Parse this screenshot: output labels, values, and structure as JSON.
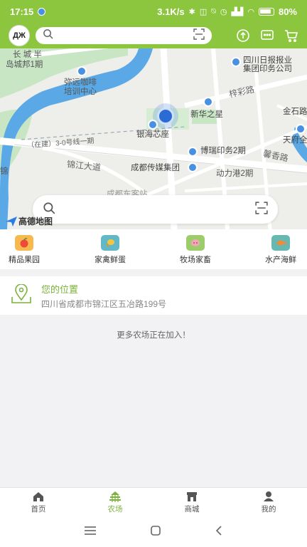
{
  "status_bar": {
    "time": "17:15",
    "network_speed": "3.1K/s",
    "battery": "80%",
    "icons": [
      "telegram-icon",
      "bluetooth-icon",
      "vibrate-icon",
      "mute-icon",
      "alarm-icon",
      "signal-hd-icon",
      "wifi-icon",
      "battery-icon"
    ]
  },
  "header": {
    "logo_text": "ДЖ",
    "search_placeholder": "",
    "icons": [
      "search-icon",
      "scan-icon",
      "upload-icon",
      "message-icon",
      "cart-icon"
    ]
  },
  "map": {
    "labels": {
      "changcheng": "长 城  半",
      "daocheng": "岛城邦1期",
      "miyuan": "弥远咖啡",
      "peixun": "培训中心",
      "ribao": "四川日报报业",
      "yinwu_gongsi": "集团印务公司",
      "yinhai": "银海芯座",
      "xinhua": "新华之星",
      "borui": "博瑞印务2期",
      "chuanmei": "成都传媒集团",
      "dongli": "动力港2期",
      "jinshi": "金石路",
      "tianfu": "天府全",
      "xiangjiang": "馨香路",
      "jinjiang": "锦江大道",
      "yicai": "梓彩路",
      "zaijian": "（在建）3-0号线一期",
      "chengdu_fragment": "成都东客站",
      "jin_side": "锦",
      "gaode": "高德地图"
    },
    "search_placeholder": ""
  },
  "categories": [
    {
      "label": "精品果园",
      "icon": "fruit-icon",
      "color": "#f6b94d"
    },
    {
      "label": "家禽鲜蛋",
      "icon": "poultry-icon",
      "color": "#62b8c9"
    },
    {
      "label": "牧场家畜",
      "icon": "livestock-icon",
      "color": "#9ccd6a"
    },
    {
      "label": "水产海鲜",
      "icon": "seafood-icon",
      "color": "#66b8b0"
    }
  ],
  "location": {
    "title": "您的位置",
    "address": "四川省成都市锦江区五冶路199号"
  },
  "more_text": "更多农场正在加入！",
  "tabs": [
    {
      "label": "首页",
      "icon": "home-icon",
      "active": false
    },
    {
      "label": "农场",
      "icon": "farm-icon",
      "active": true
    },
    {
      "label": "商城",
      "icon": "store-icon",
      "active": false
    },
    {
      "label": "我的",
      "icon": "profile-icon",
      "active": false
    }
  ],
  "colors": {
    "brand_green": "#8cc63f",
    "accent_green": "#7ab23a",
    "map_water": "#5aa9e6",
    "map_green": "#c8e6c4"
  }
}
